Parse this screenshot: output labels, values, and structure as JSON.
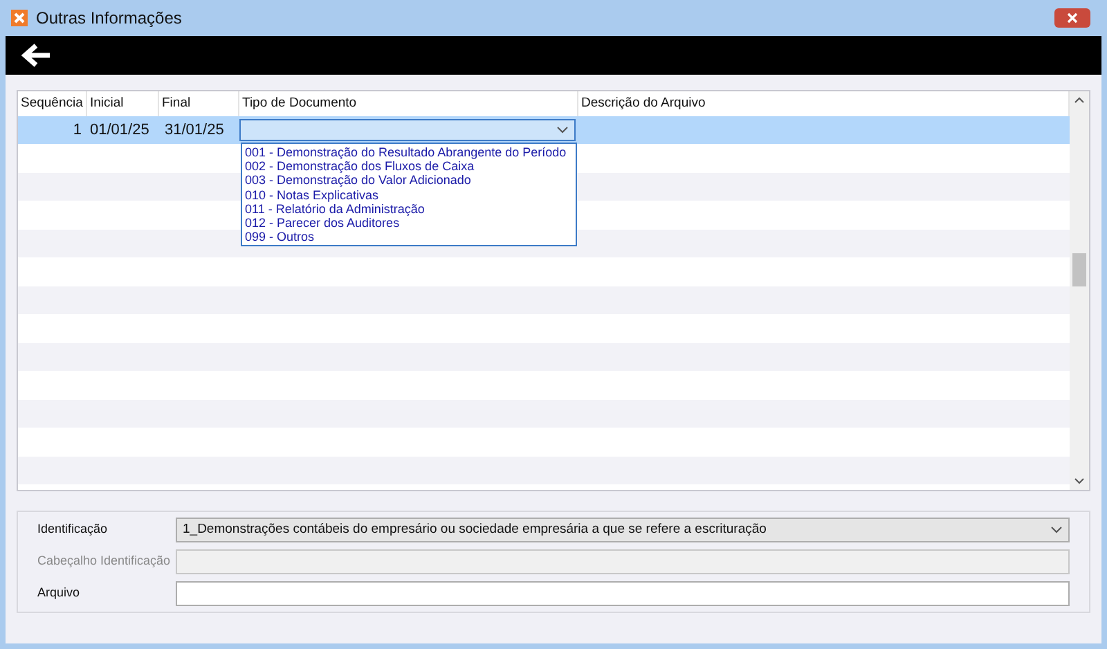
{
  "window": {
    "title": "Outras Informações"
  },
  "table": {
    "columns": [
      "Sequência",
      "Inicial",
      "Final",
      "Tipo de Documento",
      "Descrição do Arquivo"
    ],
    "rows": [
      {
        "cells": [
          "1",
          "01/01/25",
          "31/01/25"
        ],
        "selected": true
      }
    ]
  },
  "dropdown": {
    "expanded": true,
    "options": [
      {
        "label": "001 - Demonstração do Resultado Abrangente do Período",
        "selected": false
      },
      {
        "label": "002 - Demonstração dos Fluxos de Caixa",
        "selected": false
      },
      {
        "label": "003 - Demonstração do Valor Adicionado",
        "selected": false
      },
      {
        "label": "010 - Notas Explicativas",
        "selected": false
      },
      {
        "label": "011 - Relatório da Administração",
        "selected": false
      },
      {
        "label": "012 - Parecer dos Auditores",
        "selected": false
      },
      {
        "label": "099 - Outros",
        "selected": false
      }
    ]
  },
  "form": [
    {
      "kind": "combo",
      "label": "Identificação",
      "value": "1_Demonstrações contábeis do empresário ou sociedade empresária a que se refere a escrituração",
      "disabled": false
    },
    {
      "kind": "text",
      "label": "Cabeçalho Identificação",
      "disabled": true
    },
    {
      "kind": "text",
      "label": "Arquivo",
      "disabled": false
    }
  ]
}
